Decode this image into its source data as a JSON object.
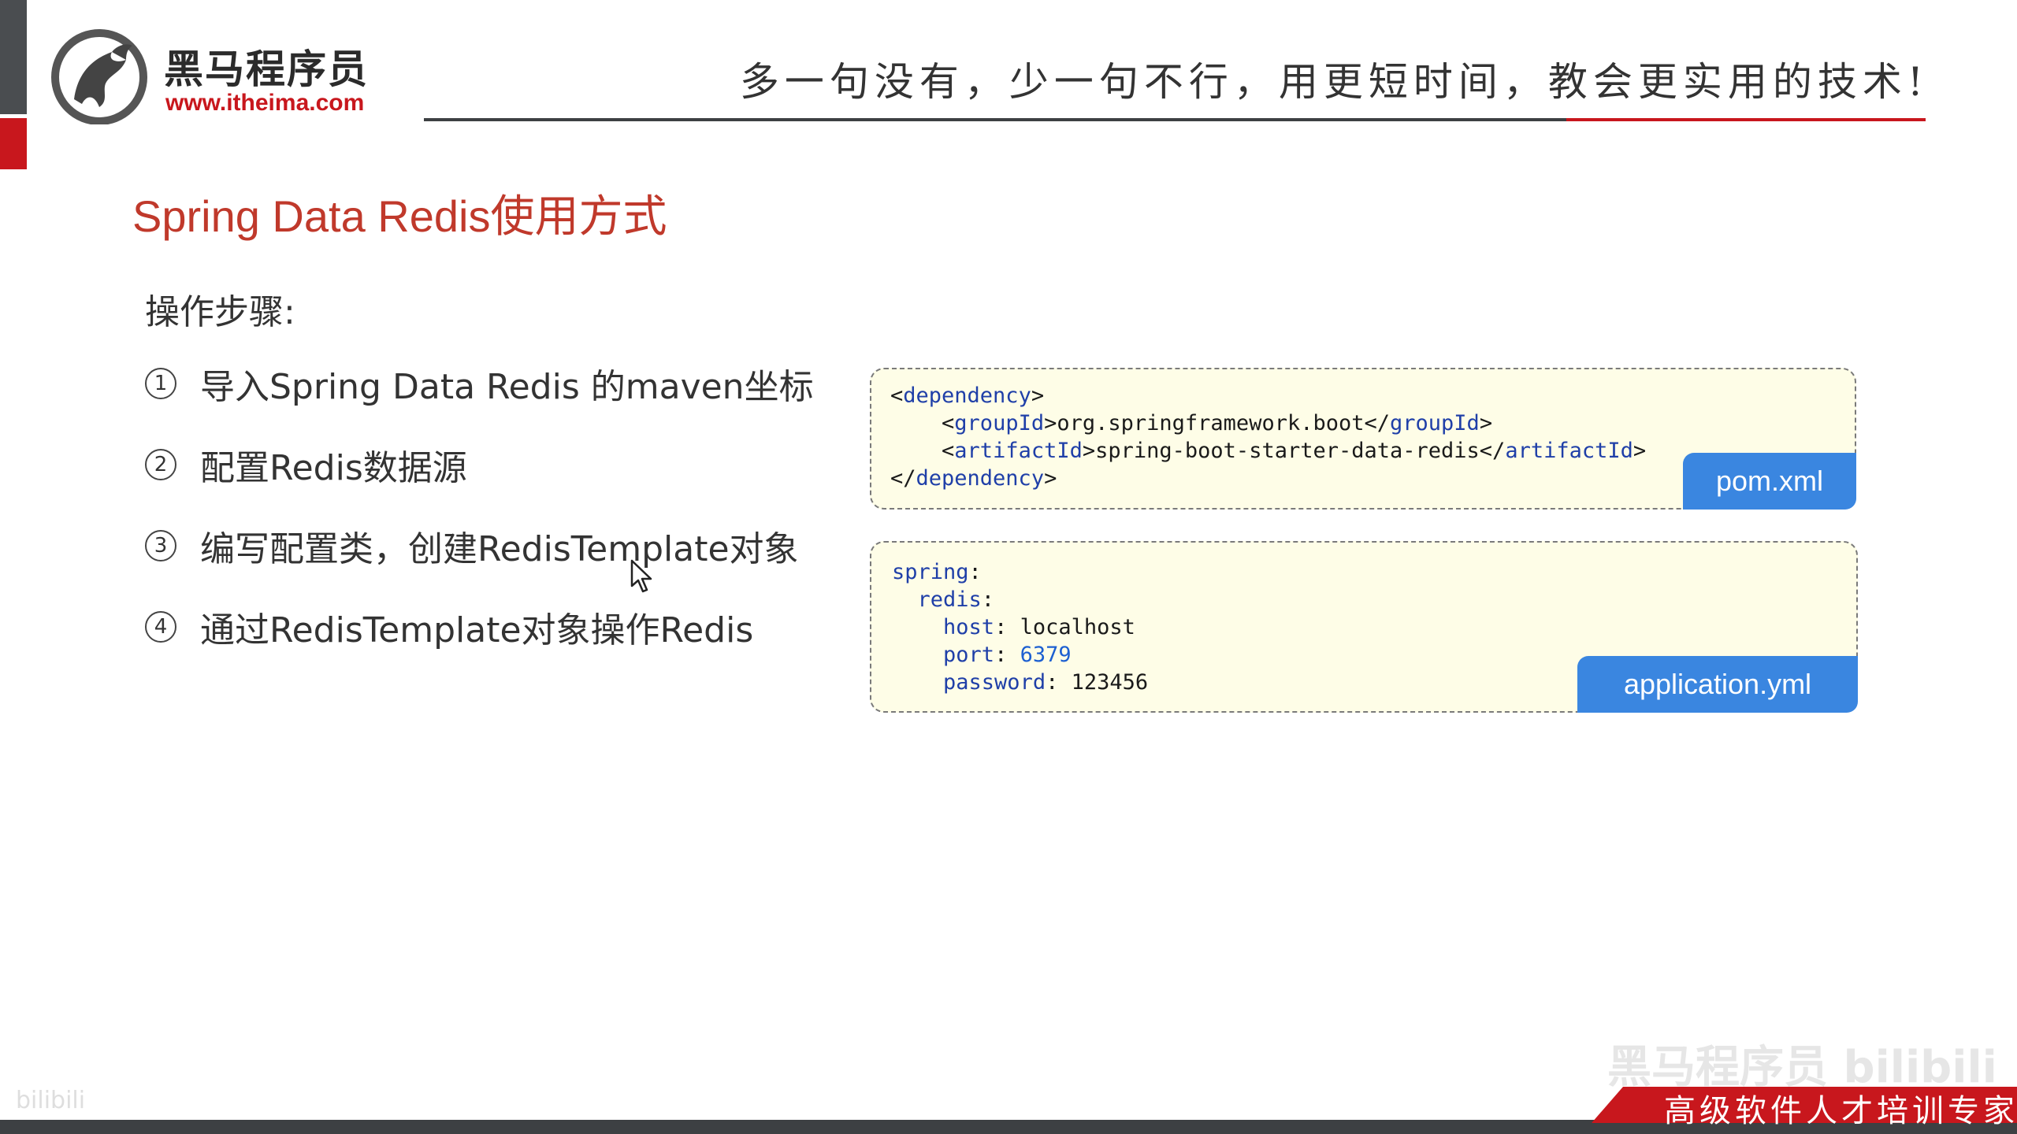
{
  "brand": {
    "name_cn": "黑马程序员",
    "url": "www.itheima.com"
  },
  "header": {
    "slogan": "多一句没有，少一句不行，用更短时间，教会更实用的技术!"
  },
  "slide": {
    "title": "Spring Data Redis使用方式",
    "steps_heading": "操作步骤:",
    "steps": [
      {
        "num": "1",
        "text": "导入Spring Data Redis 的maven坐标"
      },
      {
        "num": "2",
        "text": "配置Redis数据源"
      },
      {
        "num": "3",
        "text": "编写配置类，创建RedisTemplate对象"
      },
      {
        "num": "4",
        "text": "通过RedisTemplate对象操作Redis"
      }
    ]
  },
  "code_blocks": {
    "pom": {
      "filename": "pom.xml",
      "line1_tag": "dependency",
      "group_tag": "groupId",
      "group_value": "org.springframework.boot",
      "artifact_tag": "artifactId",
      "artifact_value": "spring-boot-starter-data-redis"
    },
    "yml": {
      "filename": "application.yml",
      "k_spring": "spring",
      "k_redis": "redis",
      "k_host": "host",
      "v_host": "localhost",
      "k_port": "port",
      "v_port": "6379",
      "k_password": "password",
      "v_password": "123456"
    }
  },
  "footer": {
    "tagline": "高级软件人才培训专家",
    "watermark": "黑马程序员 bilibili",
    "watermark_small": "bilibili"
  },
  "colors": {
    "brand_red": "#c8171d",
    "title_red": "#c0392b",
    "tab_blue": "#3a86e0",
    "code_bg": "#fefde7"
  }
}
